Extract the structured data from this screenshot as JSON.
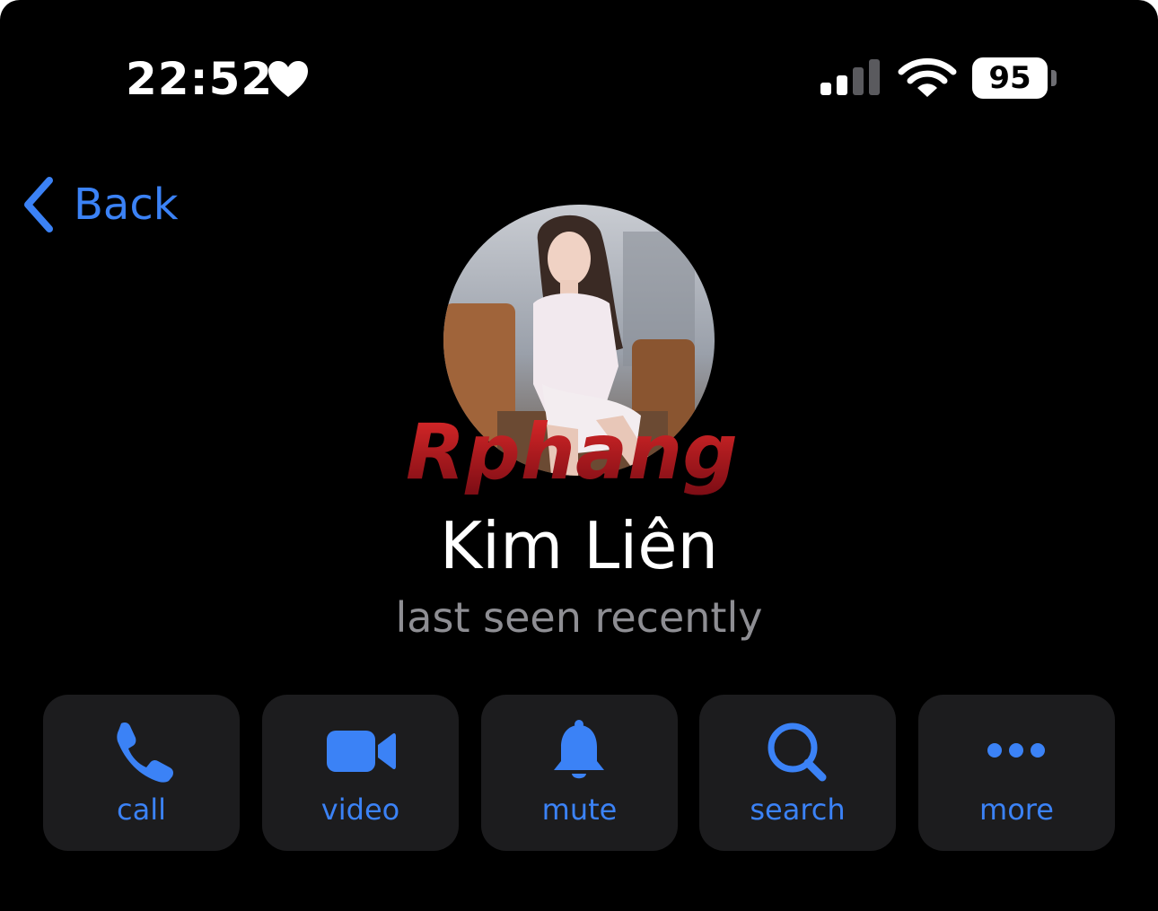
{
  "status_bar": {
    "time": "22:52",
    "battery_percent": "95",
    "icons": [
      "heart-icon",
      "cellular-signal-icon",
      "wifi-icon",
      "battery-icon"
    ]
  },
  "nav": {
    "back_label": "Back",
    "back_icon": "chevron-left-icon"
  },
  "profile": {
    "name": "Kim Liên",
    "status": "last seen recently",
    "avatar_watermark": "Rphang"
  },
  "actions": [
    {
      "label": "call",
      "icon": "phone-icon"
    },
    {
      "label": "video",
      "icon": "video-camera-icon"
    },
    {
      "label": "mute",
      "icon": "bell-icon"
    },
    {
      "label": "search",
      "icon": "magnifier-icon"
    },
    {
      "label": "more",
      "icon": "ellipsis-icon"
    }
  ],
  "colors": {
    "background": "#000000",
    "accent": "#3b82f6",
    "button_bg": "#1c1c1e",
    "secondary_text": "#8e8e93"
  }
}
